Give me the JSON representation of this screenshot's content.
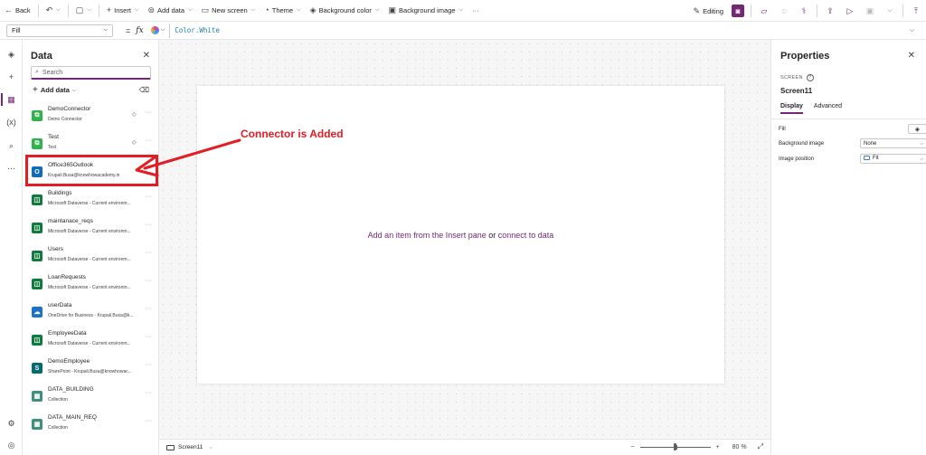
{
  "command_bar": {
    "back_label": "Back",
    "insert_label": "Insert",
    "add_data_label": "Add data",
    "new_screen_label": "New screen",
    "theme_label": "Theme",
    "background_color_label": "Background color",
    "background_image_label": "Background image",
    "more_label": "···",
    "editing_label": "Editing"
  },
  "formula_bar": {
    "property": "Fill",
    "equals": "=",
    "fx": "fx",
    "formula": "Color.White"
  },
  "data_panel": {
    "title": "Data",
    "search_placeholder": "Search",
    "add_data_label": "Add data",
    "sources": [
      {
        "name": "DemoConnector",
        "subtitle": "Demo Connector",
        "icon": "connector-icon",
        "color": "#2fb34a",
        "premium": true
      },
      {
        "name": "Test",
        "subtitle": "Test",
        "icon": "connector-icon",
        "color": "#2fb34a",
        "premium": true
      },
      {
        "name": "Office365Outlook",
        "subtitle": "Krupali.Busa@knowhowacademy.in",
        "icon": "outlook-icon",
        "color": "#0f6cbd",
        "premium": false
      },
      {
        "name": "Buildings",
        "subtitle": "Microsoft Dataverse - Current environm...",
        "icon": "dataverse-icon",
        "color": "#117a3d",
        "premium": false
      },
      {
        "name": "maintanace_reqs",
        "subtitle": "Microsoft Dataverse - Current environm...",
        "icon": "dataverse-icon",
        "color": "#117a3d",
        "premium": false
      },
      {
        "name": "Users",
        "subtitle": "Microsoft Dataverse - Current environm...",
        "icon": "dataverse-icon",
        "color": "#117a3d",
        "premium": false
      },
      {
        "name": "LoanRequests",
        "subtitle": "Microsoft Dataverse - Current environm...",
        "icon": "dataverse-icon",
        "color": "#117a3d",
        "premium": false
      },
      {
        "name": "userData",
        "subtitle": "OneDrive for Business - Krupali.Busa@k...",
        "icon": "onedrive-icon",
        "color": "#1a73c9",
        "premium": false
      },
      {
        "name": "EmployeeData",
        "subtitle": "Microsoft Dataverse - Current environm...",
        "icon": "dataverse-icon",
        "color": "#117a3d",
        "premium": false
      },
      {
        "name": "DemoEmployee",
        "subtitle": "SharePoint - Krupali.Busa@knowhowac...",
        "icon": "sharepoint-icon",
        "color": "#036c70",
        "premium": false
      },
      {
        "name": "DATA_BUILDING",
        "subtitle": "Collection",
        "icon": "collection-icon",
        "color": "#3e8f7e",
        "premium": false
      },
      {
        "name": "DATA_MAIN_REQ",
        "subtitle": "Collection",
        "icon": "collection-icon",
        "color": "#3e8f7e",
        "premium": false
      }
    ]
  },
  "annotation": {
    "text": "Connector is Added",
    "color": "#e41c23"
  },
  "canvas": {
    "message_prefix": "Add an item from the Insert pane",
    "message_or": " or ",
    "message_link": "connect to data"
  },
  "bottom_bar": {
    "screen_name": "Screen11",
    "zoom_minus": "−",
    "zoom_plus": "+",
    "zoom_value": "80",
    "zoom_unit": "%",
    "zoom_fraction": 0.48
  },
  "properties": {
    "title": "Properties",
    "kind": "SCREEN",
    "name": "Screen11",
    "tabs": [
      "Display",
      "Advanced"
    ],
    "rows": [
      {
        "label": "Fill"
      },
      {
        "label": "Background image",
        "value": "None"
      },
      {
        "label": "Image position",
        "value": "Fit"
      }
    ]
  },
  "colors": {
    "accent": "#742774",
    "annotation_red": "#e41c23"
  }
}
